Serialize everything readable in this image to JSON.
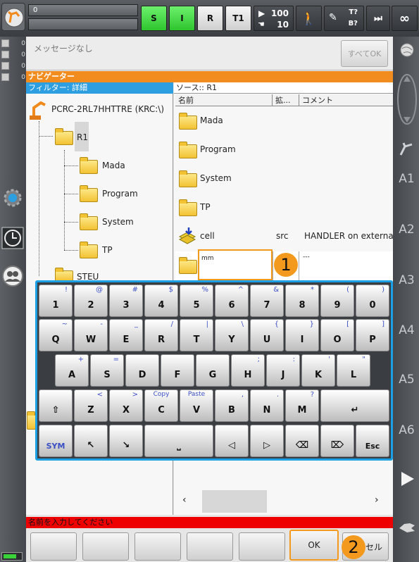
{
  "top": {
    "program_name": "0",
    "status_s": "S",
    "status_i": "I",
    "status_r": "R",
    "mode": "T1",
    "override_prog": "100",
    "override_jog": "10",
    "tool_label_top": "T?",
    "tool_label_bottom": "B?",
    "infinity": "∞"
  },
  "messages": {
    "counts": [
      "0",
      "0",
      "0",
      "0"
    ],
    "text": "メッセージなし",
    "ack_all": "すべてOK"
  },
  "navigator": {
    "title": "ナビゲーター",
    "filter": "フィルター: 詳細",
    "source": "ソース:: R1",
    "columns": {
      "name": "名前",
      "ext": "拡...",
      "comment": "コメント"
    }
  },
  "tree": {
    "root": "PCRC-2RL7HHTTRE (KRC:\\)",
    "r1": "R1",
    "children": [
      "Mada",
      "Program",
      "System",
      "TP"
    ],
    "steu": "STEU"
  },
  "files": [
    {
      "name": "Mada",
      "ext": "",
      "comment": ""
    },
    {
      "name": "Program",
      "ext": "",
      "comment": ""
    },
    {
      "name": "System",
      "ext": "",
      "comment": ""
    },
    {
      "name": "TP",
      "ext": "",
      "comment": ""
    },
    {
      "name": "cell",
      "ext": "src",
      "comment": "HANDLER on external ..."
    }
  ],
  "edit_row": {
    "value": "mm",
    "comment": "---"
  },
  "keyboard": {
    "row1": [
      [
        "1",
        "!"
      ],
      [
        "2",
        "@"
      ],
      [
        "3",
        "#"
      ],
      [
        "4",
        "$"
      ],
      [
        "5",
        "%"
      ],
      [
        "6",
        "^"
      ],
      [
        "7",
        "&"
      ],
      [
        "8",
        "*"
      ],
      [
        "9",
        "("
      ],
      [
        "0",
        ")"
      ]
    ],
    "row2": [
      [
        "Q",
        "~"
      ],
      [
        "W",
        "-"
      ],
      [
        "E",
        "_"
      ],
      [
        "R",
        "/"
      ],
      [
        "T",
        "|"
      ],
      [
        "Y",
        "\\"
      ],
      [
        "U",
        "{"
      ],
      [
        "I",
        "}"
      ],
      [
        "O",
        "["
      ],
      [
        "P",
        "]"
      ]
    ],
    "row3": [
      [
        "A",
        "+"
      ],
      [
        "S",
        "="
      ],
      [
        "D",
        ""
      ],
      [
        "F",
        ""
      ],
      [
        "G",
        ""
      ],
      [
        "H",
        ";"
      ],
      [
        "J",
        ":"
      ],
      [
        "K",
        "'"
      ],
      [
        "L",
        "\""
      ]
    ],
    "row4": [
      [
        "Z",
        "<"
      ],
      [
        "X",
        ">"
      ],
      [
        "C",
        "Copy"
      ],
      [
        "V",
        "Paste"
      ],
      [
        "B",
        ","
      ],
      [
        "N",
        "."
      ],
      [
        "M",
        "?"
      ]
    ],
    "sym": "SYM",
    "esc": "Esc"
  },
  "status_text": "名前を入力してください",
  "softkeys": {
    "ok": "OK",
    "cancel": "セル"
  },
  "callouts": [
    "1",
    "2"
  ],
  "right_axes": [
    "A1",
    "A2",
    "A3",
    "A4",
    "A5",
    "A6"
  ]
}
